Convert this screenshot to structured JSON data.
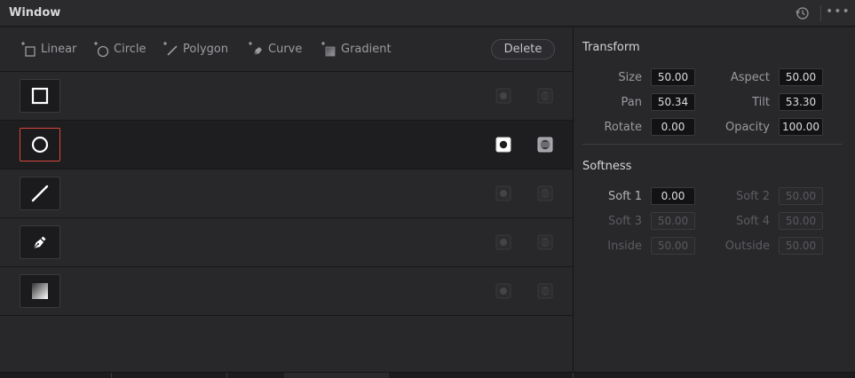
{
  "window": {
    "title": "Window"
  },
  "toolbar": {
    "tools": [
      {
        "label": "Linear",
        "icon": "linear-tool-icon"
      },
      {
        "label": "Circle",
        "icon": "circle-tool-icon"
      },
      {
        "label": "Polygon",
        "icon": "polygon-tool-icon"
      },
      {
        "label": "Curve",
        "icon": "curve-tool-icon"
      },
      {
        "label": "Gradient",
        "icon": "gradient-tool-icon"
      }
    ],
    "delete_label": "Delete"
  },
  "windows_list": [
    {
      "shape": "square-shape-icon",
      "selected": false,
      "active": false
    },
    {
      "shape": "circle-shape-icon",
      "selected": true,
      "active": true
    },
    {
      "shape": "line-shape-icon",
      "selected": false,
      "active": false
    },
    {
      "shape": "pen-shape-icon",
      "selected": false,
      "active": false
    },
    {
      "shape": "gradient-shape-icon",
      "selected": false,
      "active": false
    }
  ],
  "transform": {
    "title": "Transform",
    "size": {
      "label": "Size",
      "value": "50.00"
    },
    "aspect": {
      "label": "Aspect",
      "value": "50.00"
    },
    "pan": {
      "label": "Pan",
      "value": "50.34"
    },
    "tilt": {
      "label": "Tilt",
      "value": "53.30"
    },
    "rotate": {
      "label": "Rotate",
      "value": "0.00"
    },
    "opacity": {
      "label": "Opacity",
      "value": "100.00"
    }
  },
  "softness": {
    "title": "Softness",
    "soft1": {
      "label": "Soft 1",
      "value": "0.00"
    },
    "soft2": {
      "label": "Soft 2",
      "value": "50.00"
    },
    "soft3": {
      "label": "Soft 3",
      "value": "50.00"
    },
    "soft4": {
      "label": "Soft 4",
      "value": "50.00"
    },
    "inside": {
      "label": "Inside",
      "value": "50.00"
    },
    "outside": {
      "label": "Outside",
      "value": "50.00"
    }
  },
  "colors": {
    "selected_border": "#d9473e",
    "accent_white": "#ffffff"
  }
}
